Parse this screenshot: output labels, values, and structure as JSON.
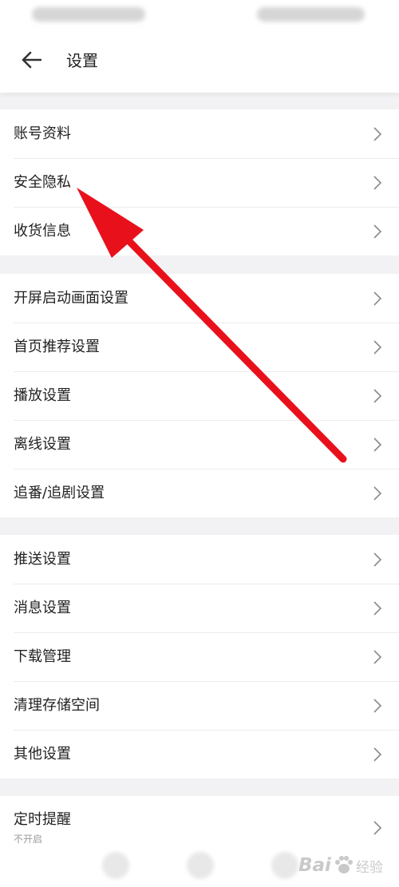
{
  "header": {
    "title": "设置"
  },
  "sections": [
    {
      "items": [
        {
          "label": "账号资料"
        },
        {
          "label": "安全隐私"
        },
        {
          "label": "收货信息"
        }
      ]
    },
    {
      "items": [
        {
          "label": "开屏启动画面设置"
        },
        {
          "label": "首页推荐设置"
        },
        {
          "label": "播放设置"
        },
        {
          "label": "离线设置"
        },
        {
          "label": "追番/追剧设置"
        }
      ]
    },
    {
      "items": [
        {
          "label": "推送设置"
        },
        {
          "label": "消息设置"
        },
        {
          "label": "下载管理"
        },
        {
          "label": "清理存储空间"
        },
        {
          "label": "其他设置"
        }
      ]
    },
    {
      "items": [
        {
          "label": "定时提醒",
          "sub": "不开启"
        }
      ]
    }
  ],
  "annotation": {
    "color": "#e8111b"
  },
  "watermark": {
    "brand": "Bai",
    "suffix": "经验"
  },
  "colors": {
    "background": "#f2f2f4",
    "surface": "#ffffff",
    "text": "#222222",
    "chevron": "#8a8a8a"
  }
}
